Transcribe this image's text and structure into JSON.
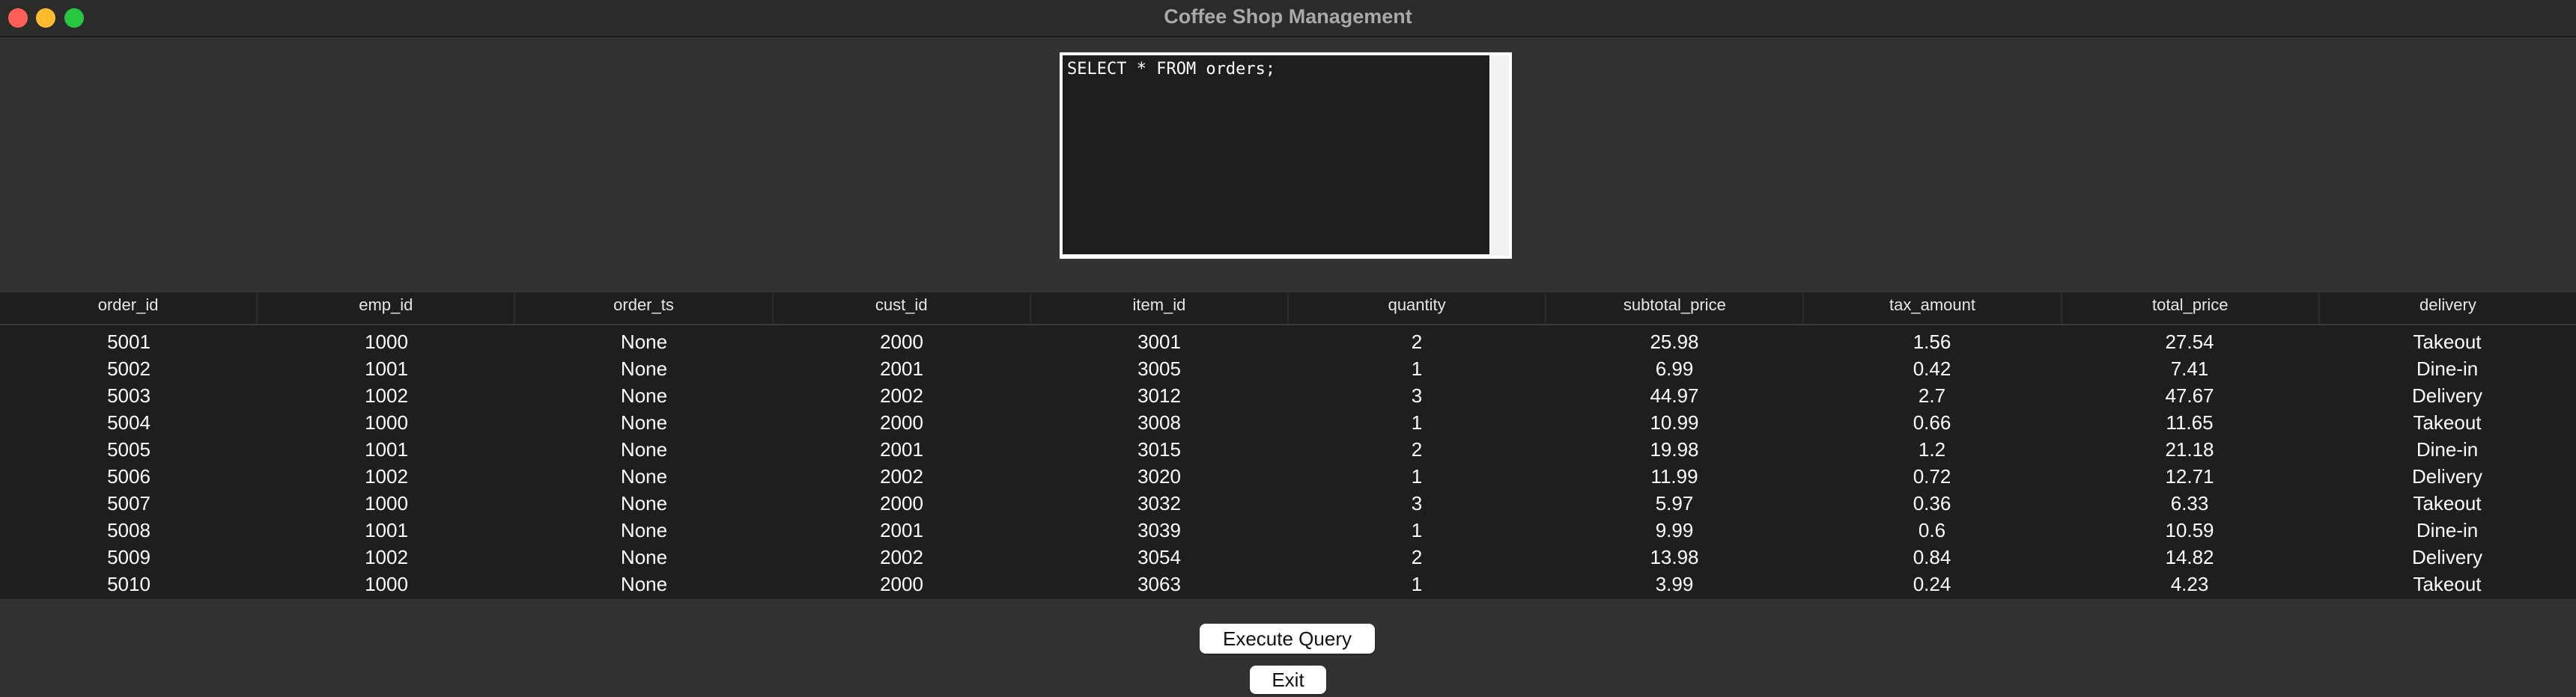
{
  "window": {
    "title": "Coffee Shop Management"
  },
  "query": {
    "text": "SELECT * FROM orders;"
  },
  "table": {
    "columns": [
      "order_id",
      "emp_id",
      "order_ts",
      "cust_id",
      "item_id",
      "quantity",
      "subtotal_price",
      "tax_amount",
      "total_price",
      "delivery"
    ],
    "rows": [
      [
        "5001",
        "1000",
        "None",
        "2000",
        "3001",
        "2",
        "25.98",
        "1.56",
        "27.54",
        "Takeout"
      ],
      [
        "5002",
        "1001",
        "None",
        "2001",
        "3005",
        "1",
        "6.99",
        "0.42",
        "7.41",
        "Dine-in"
      ],
      [
        "5003",
        "1002",
        "None",
        "2002",
        "3012",
        "3",
        "44.97",
        "2.7",
        "47.67",
        "Delivery"
      ],
      [
        "5004",
        "1000",
        "None",
        "2000",
        "3008",
        "1",
        "10.99",
        "0.66",
        "11.65",
        "Takeout"
      ],
      [
        "5005",
        "1001",
        "None",
        "2001",
        "3015",
        "2",
        "19.98",
        "1.2",
        "21.18",
        "Dine-in"
      ],
      [
        "5006",
        "1002",
        "None",
        "2002",
        "3020",
        "1",
        "11.99",
        "0.72",
        "12.71",
        "Delivery"
      ],
      [
        "5007",
        "1000",
        "None",
        "2000",
        "3032",
        "3",
        "5.97",
        "0.36",
        "6.33",
        "Takeout"
      ],
      [
        "5008",
        "1001",
        "None",
        "2001",
        "3039",
        "1",
        "9.99",
        "0.6",
        "10.59",
        "Dine-in"
      ],
      [
        "5009",
        "1002",
        "None",
        "2002",
        "3054",
        "2",
        "13.98",
        "0.84",
        "14.82",
        "Delivery"
      ],
      [
        "5010",
        "1000",
        "None",
        "2000",
        "3063",
        "1",
        "3.99",
        "0.24",
        "4.23",
        "Takeout"
      ]
    ]
  },
  "buttons": {
    "execute_label": "Execute Query",
    "exit_label": "Exit"
  }
}
